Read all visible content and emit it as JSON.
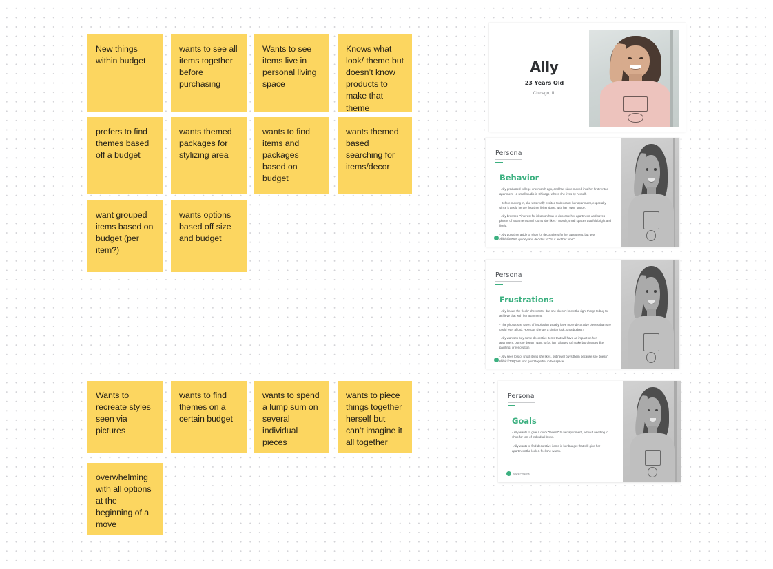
{
  "board": {
    "background_color": "#ffffff",
    "dot_color": "#d2d2d6"
  },
  "sticky_notes": {
    "color": "#fcd660",
    "group_top": [
      {
        "text": "New things within budget"
      },
      {
        "text": "wants to see all items together before purchasing"
      },
      {
        "text": "Wants to see items live in personal living space"
      },
      {
        "text": "Knows what look/ theme but doesn’t know products to make that theme"
      },
      {
        "text": "prefers to find themes based off a budget"
      },
      {
        "text": "wants themed packages for stylizing area"
      },
      {
        "text": "wants to find items and packages based on budget"
      },
      {
        "text": "wants themed based searching for items/decor"
      },
      {
        "text": "want grouped items based on budget (per item?)"
      },
      {
        "text": "wants options based off size and budget"
      }
    ],
    "group_bottom": [
      {
        "text": "Wants to recreate styles seen via pictures"
      },
      {
        "text": "wants to find themes on a certain budget"
      },
      {
        "text": "wants to spend a lump sum on several individual pieces"
      },
      {
        "text": "wants to piece things together herself but can’t imagine it all together"
      },
      {
        "text": "overwhelming with all options at the beginning of a move"
      }
    ]
  },
  "slides": {
    "accent_color": "#3cb080",
    "cover": {
      "name": "Ally",
      "age": "23 Years Old",
      "location": "Chicago, IL"
    },
    "behavior": {
      "kicker": "Persona",
      "heading": "Behavior",
      "bullets": [
        "- Ally graduated college one month ago, and has since moved into her first rented apartment - a small studio in Chicago, where she lives by herself.",
        "- Before moving in,  she was really excited to decorate her apartment, especially since it would be the first time living alone,  with her “own” space.",
        "- Ally browses Pinterest for ideas on how to decorate her apartment, and saves photos of apartments and rooms she likes - mostly, small spaces that felt bright and lively.",
        "- Ally puts time aside to shop for decorations for her apartment, but gets overwhelmed quickly and decides to “do it another time”"
      ],
      "logo_text": "Ally’s Persona"
    },
    "frustrations": {
      "kicker": "Persona",
      "heading": "Frustrations",
      "bullets": [
        "- Ally knows the “look” she wants - but she doesn’t know the right things to buy to achieve that with her apartment.",
        "- The photos she saves of inspiration usually have more decorative pieces than she could ever afford. How can she get a similar look, on a budget?",
        "- Ally wants to buy some decorative items that will have an impact on her apartment, but she doesn’t want to (or, isn’t allowed to) make big changes like painting, or renovation.",
        "- Ally sees lots of small items she likes, but never buys them because she doesn’t know if they will look good together in her space."
      ],
      "logo_text": "Ally’s Persona"
    },
    "goals": {
      "kicker": "Persona",
      "heading": "Goals",
      "bullets": [
        "- Ally wants to give a quick “facelift” to her apartment, without needing to shop for lots of individual items.",
        "- Ally wants to find decorative items in her budget that will give her apartment the look & feel she wants."
      ],
      "logo_text": "Ally’s Persona"
    }
  }
}
